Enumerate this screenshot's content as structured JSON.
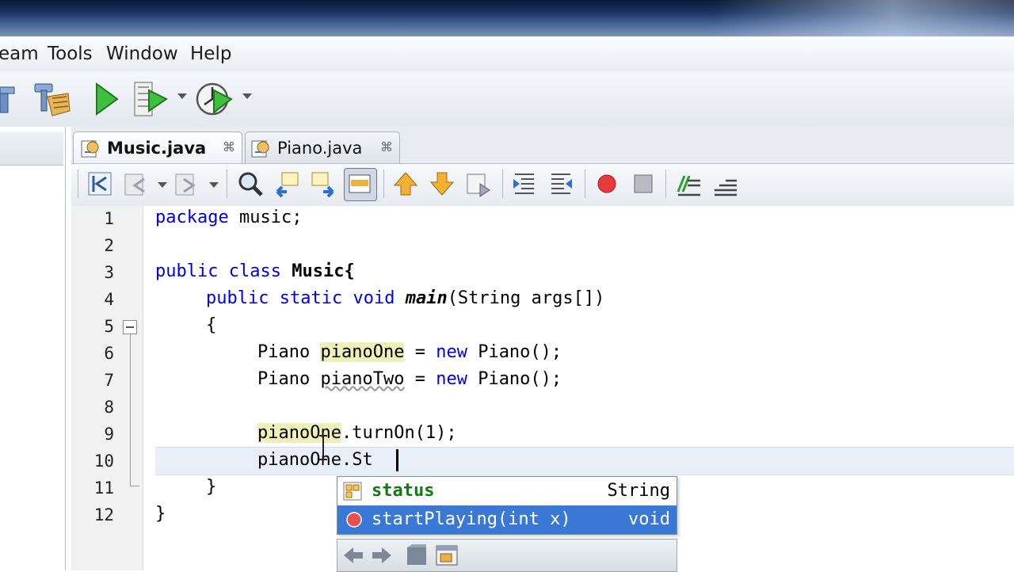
{
  "menu": [
    "eam",
    "Tools",
    "Window",
    "Help"
  ],
  "tabs": [
    {
      "label": "Music.java",
      "close": "⌘",
      "active": true
    },
    {
      "label": "Piano.java",
      "close": "⌘",
      "active": false
    }
  ],
  "gutter": {
    "line_numbers": [
      "1",
      "2",
      "3",
      "4",
      "5",
      "6",
      "7",
      "8",
      "9",
      "10",
      "11",
      "12"
    ]
  },
  "code": {
    "l1": {
      "kw": "package",
      "rest": " music;"
    },
    "l3": {
      "kw1": "public",
      "kw2": "class",
      "name": "Music{"
    },
    "l4": {
      "kw1": "public",
      "kw2": "static",
      "kw3": "void",
      "method": "main",
      "rest": "(String args[])"
    },
    "l5": "{",
    "l6": {
      "type": "Piano",
      "var": "pianoOne",
      "eq": " = ",
      "kw": "new",
      "rest": " Piano();"
    },
    "l7": {
      "type": "Piano",
      "var": "pianoTwo",
      "eq": " = ",
      "kw": "new",
      "rest": " Piano();"
    },
    "l9": {
      "var": "pianoOne",
      "rest": ".turnOn(1);"
    },
    "l10": "pianoOne.St",
    "l11": "}",
    "l12": "}"
  },
  "completion": {
    "items": [
      {
        "name": "status",
        "type": "String",
        "icon": "field-icon",
        "selected": false
      },
      {
        "name": "startPlaying(int x)",
        "type": "void",
        "icon": "method-icon",
        "selected": true
      }
    ]
  },
  "colors": {
    "keyword": "#0000e6",
    "selection": "#3a78d6",
    "highlight": "#eef0b8",
    "method_dot": "#e04040"
  }
}
